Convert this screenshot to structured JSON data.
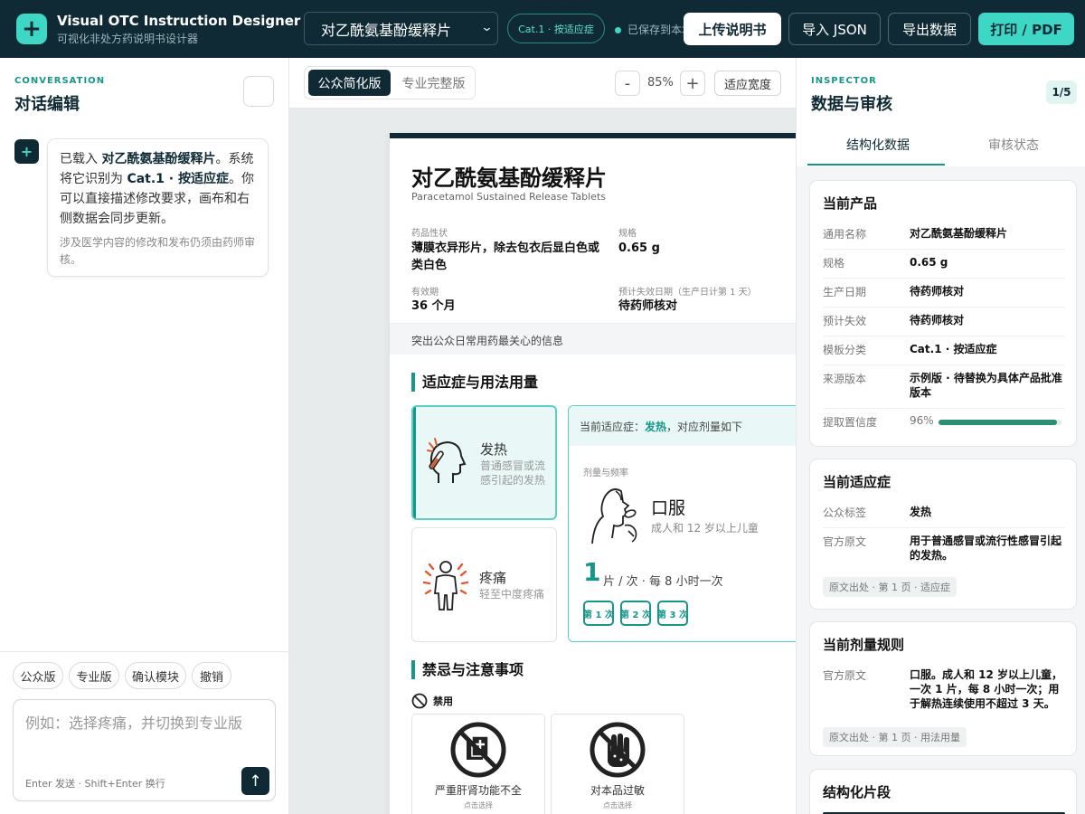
{
  "app": {
    "title": "Visual OTC Instruction Designer",
    "subtitle": "可视化非处方药说明书设计器",
    "logo_glyph": "+",
    "product_select": "对乙酰氨基酚缓释片",
    "category_pill": "Cat.1 · 按适应症",
    "save_status": "已保存到本地",
    "buttons": {
      "upload": "上传说明书",
      "import": "导入 JSON",
      "export": "导出数据",
      "print": "打印 / PDF"
    },
    "colors": {
      "brand": "#0f2a35",
      "accent": "#3ed6c4",
      "teal": "#17968a"
    }
  },
  "conversation": {
    "eyebrow": "CONVERSATION",
    "title": "对话编辑",
    "avatar_glyph": "+",
    "message": {
      "part1": "已载入 ",
      "product": "对乙酰氨基酚缓释片",
      "part2": "。系统将它识别为 ",
      "category": "Cat.1 · 按适应症",
      "part3": "。你可以直接描述修改要求，画布和右侧数据会同步更新。",
      "note": "涉及医学内容的修改和发布仍须由药师审核。"
    },
    "chips": [
      "公众版",
      "专业版",
      "确认模块",
      "撤销"
    ],
    "input_placeholder": "例如：选择疼痛，并切换到专业版",
    "input_hint": "Enter 发送 · Shift+Enter 换行",
    "send_icon": "arrow-up-icon"
  },
  "canvas": {
    "tabs": {
      "public": "公众简化版",
      "pro": "专业完整版"
    },
    "zoom": {
      "minus": "-",
      "value": "85%",
      "plus": "+",
      "fit": "适应宽度"
    },
    "doc": {
      "name_cn": "对乙酰氨基酚缓释片",
      "name_en": "Paracetamol Sustained Release Tablets",
      "fields": [
        {
          "label": "药品性状",
          "value": "薄膜衣异形片，除去包衣后显白色或类白色"
        },
        {
          "label": "规格",
          "value": "0.65 g"
        },
        {
          "label": "有效期",
          "value": "36 个月"
        },
        {
          "label": "预计失效日期（生产日计第 1 天）",
          "value": "待药师核对"
        }
      ],
      "band": "突出公众日常用药最关心的信息",
      "section1": "适应症与用法用量",
      "indications": [
        {
          "title": "发热",
          "desc": "普通感冒或流感引起的发热",
          "icon": "fever-head-icon"
        },
        {
          "title": "疼痛",
          "desc": "轻至中度疼痛",
          "icon": "pain-body-icon"
        }
      ],
      "dose": {
        "head_prefix": "当前适应症：",
        "head_indication": "发热",
        "head_suffix": "，对应剂量如下",
        "label": "剂量与频率",
        "route": "口服",
        "route_sub": "成人和 12 岁以上儿童",
        "amount": "1",
        "frequency": "片 / 次 · 每 8 小时一次",
        "times": [
          "第 1 次",
          "第 2 次",
          "第 3 次"
        ]
      },
      "section2": "禁忌与注意事项",
      "forbid_label": "禁用",
      "contraindications": [
        {
          "title": "严重肝肾功能不全",
          "sub": "点击选择",
          "icon": "no-organ-icon"
        },
        {
          "title": "对本品过敏",
          "sub": "点击选择",
          "icon": "no-allergy-icon"
        }
      ]
    }
  },
  "inspector": {
    "eyebrow": "INSPECTOR",
    "title": "数据与审核",
    "pager": "1/5",
    "tabs": [
      "结构化数据",
      "审核状态"
    ],
    "product_card": {
      "title": "当前产品",
      "rows": [
        {
          "k": "通用名称",
          "v": "对乙酰氨基酚缓释片"
        },
        {
          "k": "规格",
          "v": "0.65 g"
        },
        {
          "k": "生产日期",
          "v": "待药师核对"
        },
        {
          "k": "预计失效",
          "v": "待药师核对"
        },
        {
          "k": "模板分类",
          "v": "Cat.1 · 按适应症"
        },
        {
          "k": "来源版本",
          "v": "示例版 · 待替换为具体产品批准版本"
        }
      ],
      "confidence_label": "提取置信度",
      "confidence_value": "96%",
      "confidence_fraction": 0.96
    },
    "indication_card": {
      "title": "当前适应症",
      "rows": [
        {
          "k": "公众标签",
          "v": "发热"
        },
        {
          "k": "官方原文",
          "v": "用于普通感冒或流行性感冒引起的发热。"
        }
      ],
      "source": "原文出处 · 第 1 页 · 适应症"
    },
    "dose_card": {
      "title": "当前剂量规则",
      "rows": [
        {
          "k": "官方原文",
          "v": "口服。成人和 12 岁以上儿童，一次 1 片，每 8 小时一次；用于解热连续使用不超过 3 天。"
        }
      ],
      "source": "原文出处 · 第 1 页 · 用法用量"
    },
    "segment_card": {
      "title": "结构化片段"
    }
  }
}
